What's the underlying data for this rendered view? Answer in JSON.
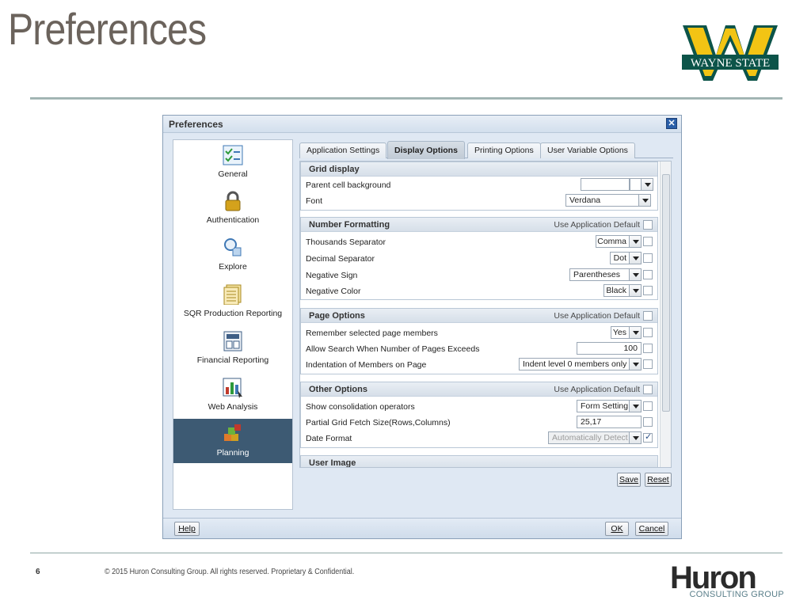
{
  "slide": {
    "title": "Preferences",
    "page_number": "6",
    "copyright": "© 2015 Huron Consulting Group. All rights reserved. Proprietary & Confidential.",
    "logo_top": "WAYNE STATE",
    "logo_bottom_word": "Huron",
    "logo_bottom_sub": "CONSULTING GROUP"
  },
  "dialog": {
    "title": "Preferences",
    "close_icon": "close-icon",
    "nav": [
      {
        "label": "General",
        "icon": "checklist-icon"
      },
      {
        "label": "Authentication",
        "icon": "lock-icon"
      },
      {
        "label": "Explore",
        "icon": "explore-icon"
      },
      {
        "label": "SQR Production Reporting",
        "icon": "report-icon"
      },
      {
        "label": "Financial Reporting",
        "icon": "financial-report-icon"
      },
      {
        "label": "Web Analysis",
        "icon": "chart-icon"
      },
      {
        "label": "Planning",
        "icon": "planning-icon"
      }
    ],
    "tabs": [
      "Application Settings",
      "Display Options",
      "Printing Options",
      "User Variable Options"
    ],
    "active_tab": "Display Options",
    "use_app_default": "Use Application Default",
    "grid_display": {
      "title": "Grid display",
      "parent_cell_background": "Parent cell background",
      "font_label": "Font",
      "font_value": "Verdana"
    },
    "number_formatting": {
      "title": "Number Formatting",
      "thousands_label": "Thousands Separator",
      "thousands_value": "Comma",
      "decimal_label": "Decimal Separator",
      "decimal_value": "Dot",
      "negative_sign_label": "Negative Sign",
      "negative_sign_value": "Parentheses",
      "negative_color_label": "Negative Color",
      "negative_color_value": "Black"
    },
    "page_options": {
      "title": "Page Options",
      "remember_label": "Remember selected page members",
      "remember_value": "Yes",
      "search_label": "Allow Search When Number of Pages Exceeds",
      "search_value": "100",
      "indent_label": "Indentation of Members on Page",
      "indent_value": "Indent level 0 members only"
    },
    "other_options": {
      "title": "Other Options",
      "consolidation_label": "Show consolidation operators",
      "consolidation_value": "Form Setting",
      "fetch_label": "Partial Grid Fetch Size(Rows,Columns)",
      "fetch_value": "25,17",
      "date_label": "Date Format",
      "date_value": "Automatically Detect"
    },
    "user_image": {
      "title": "User Image"
    },
    "save_label": "Save",
    "reset_label": "Reset",
    "help_label": "Help",
    "ok_label": "OK",
    "cancel_label": "Cancel"
  }
}
